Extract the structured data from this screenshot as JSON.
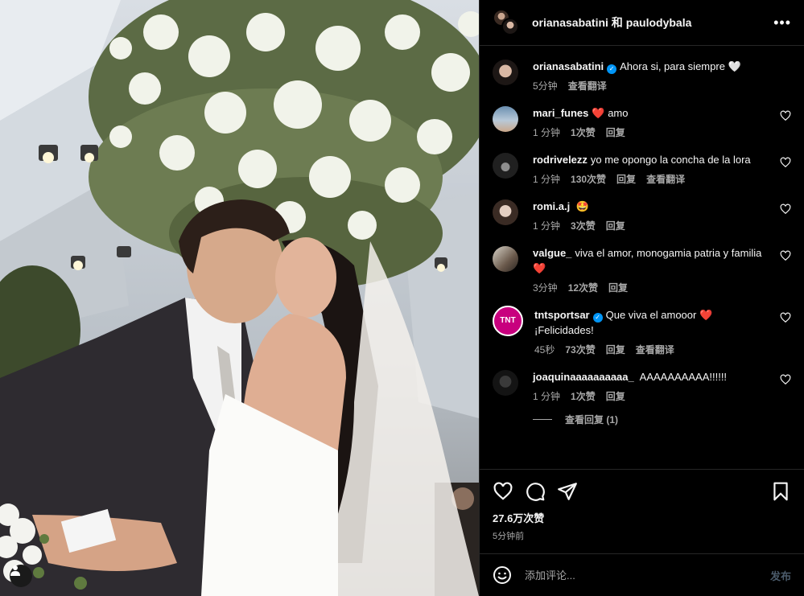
{
  "header": {
    "title": "orianasabatini 和 paulodybala"
  },
  "post": {
    "author": "orianasabatini",
    "caption": "Ahora si, para siempre 🤍",
    "time": "5分钟",
    "translate": "查看翻译"
  },
  "comments": [
    {
      "user": "mari_funes",
      "emoji": "❤️",
      "text": "amo",
      "time": "1 分钟",
      "likes": "1次赞",
      "reply": "回复"
    },
    {
      "user": "rodrivelezz",
      "text": "yo me opongo la concha de la lora",
      "time": "1 分钟",
      "likes": "130次赞",
      "reply": "回复",
      "translate": "查看翻译"
    },
    {
      "user": "romi.a.j",
      "text": "🤩",
      "time": "1 分钟",
      "likes": "3次赞",
      "reply": "回复"
    },
    {
      "user": "valgue_",
      "text": "viva el amor, monogamia patria y familia",
      "emoji": "❤️",
      "time": "3分钟",
      "likes": "12次赞",
      "reply": "回复"
    },
    {
      "user": "tntsportsar",
      "text": "Que viva el amooor",
      "emoji": "❤️",
      "text2": "¡Felicidades!",
      "time": "45秒",
      "likes": "73次赞",
      "reply": "回复",
      "translate": "查看翻译"
    },
    {
      "user": "joaquinaaaaaaaaaa_",
      "text": "AAAAAAAAAA!!!!!!",
      "time": "1 分钟",
      "likes": "1次赞",
      "reply": "回复"
    }
  ],
  "view_replies": "查看回复 (1)",
  "stats": {
    "likes": "27.6万次赞",
    "posted": "5分钟前"
  },
  "add_comment": {
    "placeholder": "添加评论...",
    "post_label": "发布"
  },
  "icons": {
    "more": "more-icon",
    "like": "heart-icon",
    "comment": "comment-icon",
    "share": "send-icon",
    "save": "bookmark-icon",
    "emoji": "emoji-icon",
    "user_tag": "user-icon"
  },
  "colors": {
    "background": "#000000",
    "text": "#f5f5f5",
    "muted": "#a8a8a8",
    "verified": "#0095f6",
    "heart": "#ed1c3b"
  }
}
